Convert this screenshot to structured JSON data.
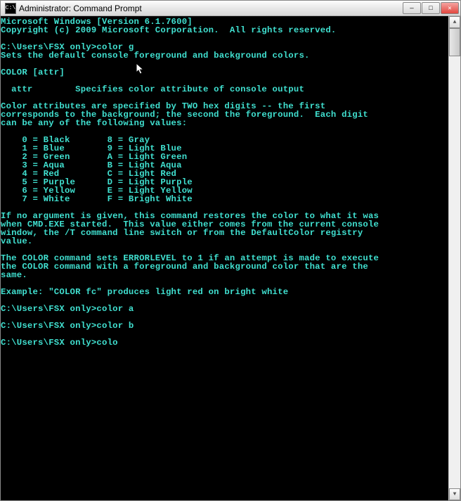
{
  "window": {
    "title": "Administrator: Command Prompt",
    "icon_label": "C:\\"
  },
  "titlebar_buttons": {
    "minimize": "—",
    "maximize": "□",
    "close": "✕"
  },
  "console": {
    "text_color": "#40e0d0",
    "background_color": "#000000",
    "lines": [
      "Microsoft Windows [Version 6.1.7600]",
      "Copyright (c) 2009 Microsoft Corporation.  All rights reserved.",
      "",
      "C:\\Users\\FSX only>color g",
      "Sets the default console foreground and background colors.",
      "",
      "COLOR [attr]",
      "",
      "  attr        Specifies color attribute of console output",
      "",
      "Color attributes are specified by TWO hex digits -- the first",
      "corresponds to the background; the second the foreground.  Each digit",
      "can be any of the following values:",
      "",
      "    0 = Black       8 = Gray",
      "    1 = Blue        9 = Light Blue",
      "    2 = Green       A = Light Green",
      "    3 = Aqua        B = Light Aqua",
      "    4 = Red         C = Light Red",
      "    5 = Purple      D = Light Purple",
      "    6 = Yellow      E = Light Yellow",
      "    7 = White       F = Bright White",
      "",
      "If no argument is given, this command restores the color to what it was",
      "when CMD.EXE started.  This value either comes from the current console",
      "window, the /T command line switch or from the DefaultColor registry",
      "value.",
      "",
      "The COLOR command sets ERRORLEVEL to 1 if an attempt is made to execute",
      "the COLOR command with a foreground and background color that are the",
      "same.",
      "",
      "Example: \"COLOR fc\" produces light red on bright white",
      "",
      "C:\\Users\\FSX only>color a",
      "",
      "C:\\Users\\FSX only>color b",
      "",
      "C:\\Users\\FSX only>colo"
    ]
  },
  "scrollbar": {
    "up": "▲",
    "down": "▼"
  }
}
